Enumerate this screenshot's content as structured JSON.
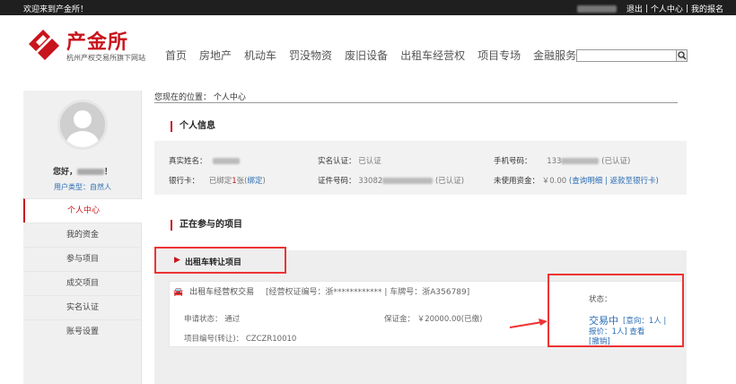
{
  "topbar": {
    "welcome": "欢迎来到产金所！",
    "links": [
      "退出",
      "个人中心",
      "我的报名"
    ],
    "sep": "|"
  },
  "header": {
    "logo_name": "产金所",
    "logo_sub": "杭州产权交易所旗下网站",
    "nav": [
      "首页",
      "房地产",
      "机动车",
      "罚没物资",
      "废旧设备",
      "出租车经营权",
      "项目专场",
      "金融服务"
    ],
    "search_placeholder": ""
  },
  "sidebar": {
    "greeting_prefix": "您好，",
    "greeting_suffix": "！",
    "user_type": "用户类型：自然人",
    "menu": [
      "个人中心",
      "我的资金",
      "参与项目",
      "成交项目",
      "实名认证",
      "账号设置"
    ]
  },
  "breadcrumb": "您现在的位置：  个人中心",
  "personal_info": {
    "title": "个人信息",
    "real_name_label": "真实姓名：",
    "realname_auth_label": "实名认证：",
    "realname_auth_value": "已认证",
    "phone_label": "手机号码：",
    "phone_prefix": "133",
    "phone_status": "(已认证)",
    "bank_label": "银行卡：",
    "bank_prefix": "已绑定",
    "bank_count": "1",
    "bank_suffix": "张(",
    "bank_link": "绑定",
    "bank_close": ")",
    "id_label": "证件号码：",
    "id_prefix": "33082",
    "id_status": "(已认证)",
    "funds_label": "未使用资金：",
    "funds_value": "￥0.00",
    "funds_link1": "查询明细",
    "funds_link2": "返款至银行卡",
    "funds_open": "(",
    "funds_sep": "|",
    "funds_close": ")"
  },
  "projects": {
    "title": "正在参与的项目",
    "tab": "出租车转让项目",
    "card": {
      "name": "出租车经营权交易",
      "meta": "[经营权证编号：浙************  |  车牌号：浙A356789]",
      "apply_status": "申请状态：  通过",
      "deposit": "保证金：  ￥20000.00(已缴)",
      "project_no": "项目编号(转让)：  CZCZR10010"
    },
    "status": {
      "label": "状态：",
      "value": "交易中",
      "intent": "[意向：1人 |",
      "offer": "报价：1人]  查看",
      "cancel": "[撤销]"
    }
  },
  "colors": {
    "brand": "#c8141c",
    "link": "#2a6db5",
    "topbar": "#1f1f1f"
  },
  "icons": {
    "search": "search-icon",
    "car": "car-icon",
    "flag": "flag-icon",
    "arrow": "arrow-right-icon",
    "avatar": "avatar-placeholder-icon"
  }
}
